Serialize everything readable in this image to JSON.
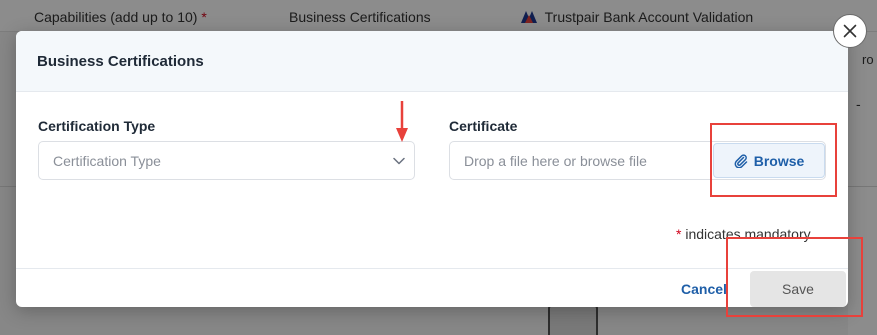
{
  "background": {
    "columns": [
      {
        "label": "Capabilities (add up to 10)",
        "required_mark": "*"
      },
      {
        "label": "Business Certifications"
      },
      {
        "label": "Trustpair Bank Account Validation",
        "icon": "trustpair-logo-icon"
      }
    ],
    "right_header_fragment": "ro",
    "right_cell_value": "-"
  },
  "modal": {
    "title": "Business Certifications",
    "certification_type": {
      "label": "Certification Type",
      "placeholder": "Certification Type",
      "icon": "chevron-down-icon"
    },
    "certificate": {
      "label": "Certificate",
      "placeholder": "Drop a file here or browse file",
      "browse_label": "Browse",
      "browse_icon": "paperclip-icon"
    },
    "mandatory_note": {
      "mark": "*",
      "text": "indicates mandatory"
    },
    "footer": {
      "cancel_label": "Cancel",
      "save_label": "Save"
    },
    "close_icon": "close-icon"
  },
  "colors": {
    "accent": "#1f5fa8",
    "required": "#d0021b",
    "annotation": "#e8413b",
    "disabled_button": "#e5e5e5"
  }
}
